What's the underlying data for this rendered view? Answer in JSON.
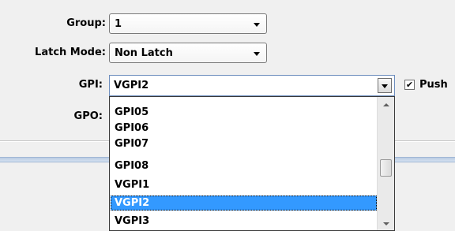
{
  "form": {
    "group": {
      "label": "Group:",
      "value": "1"
    },
    "latch_mode": {
      "label": "Latch Mode:",
      "value": "Non Latch"
    },
    "gpi": {
      "label": "GPI:",
      "value": "VGPI2"
    },
    "gpo": {
      "label": "GPO:"
    },
    "push": {
      "label": "Push",
      "checked": true
    }
  },
  "gpi_dropdown": {
    "options": [
      "GPI05",
      "GPI06",
      "GPI07",
      "GPI08",
      "VGPI1",
      "VGPI2",
      "VGPI3"
    ],
    "selected": "VGPI2"
  },
  "colors": {
    "selection": "#3399ff",
    "panel": "#f0f0f0",
    "divider": "#b9cbe3"
  }
}
